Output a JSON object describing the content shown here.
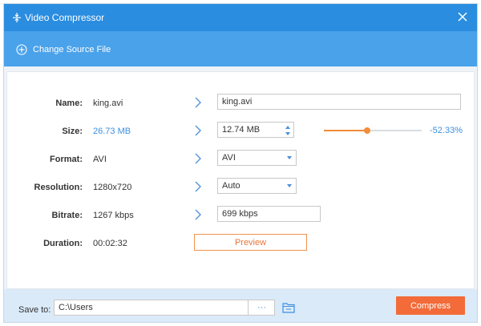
{
  "window": {
    "title": "Video Compressor"
  },
  "subbar": {
    "change_source_label": "Change Source File"
  },
  "rows": {
    "name": {
      "label": "Name:",
      "original": "king.avi",
      "output": "king.avi"
    },
    "size": {
      "label": "Size:",
      "original": "26.73 MB",
      "output": "12.74 MB",
      "percent_text": "-52.33%",
      "slider_fraction": 0.44
    },
    "format": {
      "label": "Format:",
      "original": "AVI",
      "output": "AVI"
    },
    "resolution": {
      "label": "Resolution:",
      "original": "1280x720",
      "output": "Auto"
    },
    "bitrate": {
      "label": "Bitrate:",
      "original": "1267 kbps",
      "output": "699 kbps"
    },
    "duration": {
      "label": "Duration:",
      "original": "00:02:32"
    }
  },
  "preview_label": "Preview",
  "footer": {
    "save_label": "Save to:",
    "path_value": "C:\\Users",
    "browse_label": "···",
    "compress_label": "Compress"
  },
  "icons": {
    "title": "compress-icon",
    "close": "close-icon",
    "change_source": "plus-circle-icon",
    "arrow": "chevron-right-icon",
    "folder": "folder-icon"
  },
  "colors": {
    "titlebar": "#2a8de0",
    "subbar": "#4aa2ea",
    "accent_blue": "#3a8fe0",
    "accent_orange": "#f26b39"
  }
}
